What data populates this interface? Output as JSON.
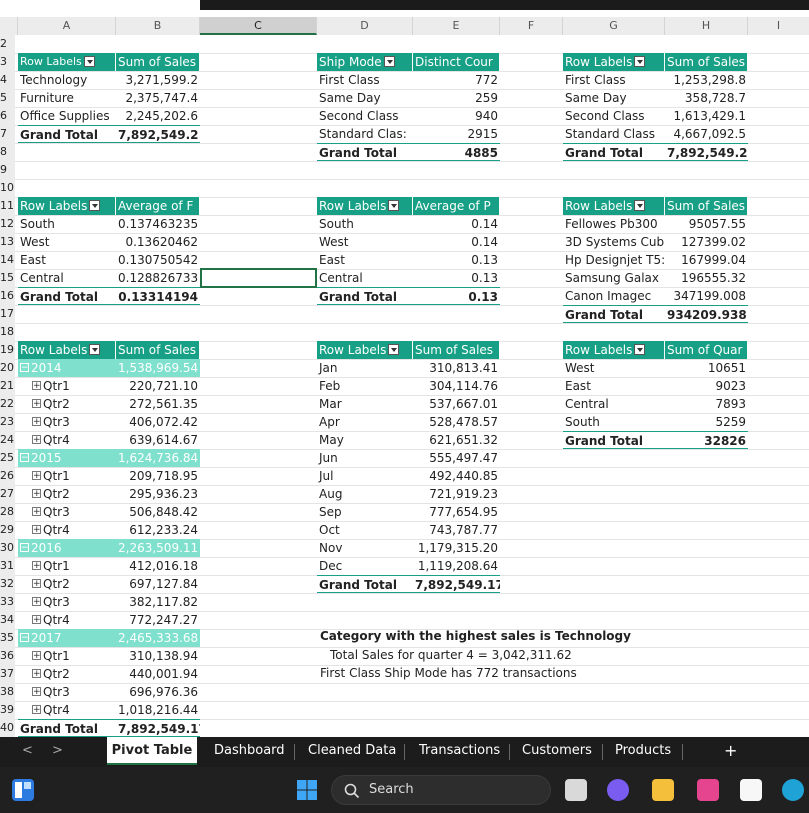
{
  "columns": [
    "A",
    "B",
    "C",
    "D",
    "E",
    "F",
    "G",
    "H",
    "I"
  ],
  "rows": [
    "2",
    "3",
    "4",
    "5",
    "6",
    "7",
    "8",
    "9",
    "10",
    "11",
    "12",
    "13",
    "14",
    "15",
    "16",
    "17",
    "18",
    "19",
    "20",
    "21",
    "22",
    "23",
    "24",
    "25",
    "26",
    "27",
    "28",
    "29",
    "30",
    "31",
    "32",
    "33",
    "34",
    "35",
    "36",
    "37",
    "38",
    "39",
    "40"
  ],
  "pivot1": {
    "headers": [
      "Row Labels",
      "Sum of Sales"
    ],
    "rows": [
      [
        "Technology",
        "3,271,599.2"
      ],
      [
        "Furniture",
        "2,375,747.4"
      ],
      [
        "Office Supplies",
        "2,245,202.6"
      ]
    ],
    "total": [
      "Grand Total",
      "7,892,549.2"
    ]
  },
  "pivot2": {
    "headers": [
      "Ship Mode",
      "Distinct Cour"
    ],
    "rows": [
      [
        "First Class",
        "772"
      ],
      [
        "Same Day",
        "259"
      ],
      [
        "Second Class",
        "940"
      ],
      [
        "Standard Clas:",
        "2915"
      ]
    ],
    "total": [
      "Grand Total",
      "4885"
    ]
  },
  "pivot3": {
    "headers": [
      "Row Labels",
      "Sum of Sales"
    ],
    "rows": [
      [
        "First Class",
        "1,253,298.8"
      ],
      [
        "Same Day",
        "358,728.7"
      ],
      [
        "Second Class",
        "1,613,429.1"
      ],
      [
        "Standard Class",
        "4,667,092.5"
      ]
    ],
    "total": [
      "Grand Total",
      "7,892,549.2"
    ]
  },
  "pivot4": {
    "headers": [
      "Row Labels",
      "Average of F"
    ],
    "rows": [
      [
        "South",
        "0.137463235"
      ],
      [
        "West",
        "0.13620462"
      ],
      [
        "East",
        "0.130750542"
      ],
      [
        "Central",
        "0.128826733"
      ]
    ],
    "total": [
      "Grand Total",
      "0.13314194"
    ]
  },
  "pivot5": {
    "headers": [
      "Row Labels",
      "Average of P"
    ],
    "rows": [
      [
        "South",
        "0.14"
      ],
      [
        "West",
        "0.14"
      ],
      [
        "East",
        "0.13"
      ],
      [
        "Central",
        "0.13"
      ]
    ],
    "total": [
      "Grand Total",
      "0.13"
    ]
  },
  "pivot6": {
    "headers": [
      "Row Labels",
      "Sum of Sales"
    ],
    "rows": [
      [
        "Fellowes Pb300",
        "95057.55"
      ],
      [
        "3D Systems Cub",
        "127399.02"
      ],
      [
        "Hp Designjet T5:",
        "167999.04"
      ],
      [
        "Samsung Galax",
        "196555.32"
      ],
      [
        "Canon Imagec",
        "347199.008"
      ]
    ],
    "total": [
      "Grand Total",
      "934209.938"
    ]
  },
  "pivot7": {
    "headers": [
      "Row Labels",
      "Sum of Sales"
    ],
    "years": [
      {
        "year": "2014",
        "total": "1,538,969.54",
        "q": [
          [
            "Qtr1",
            "220,721.10"
          ],
          [
            "Qtr2",
            "272,561.35"
          ],
          [
            "Qtr3",
            "406,072.42"
          ],
          [
            "Qtr4",
            "639,614.67"
          ]
        ]
      },
      {
        "year": "2015",
        "total": "1,624,736.84",
        "q": [
          [
            "Qtr1",
            "209,718.95"
          ],
          [
            "Qtr2",
            "295,936.23"
          ],
          [
            "Qtr3",
            "506,848.42"
          ],
          [
            "Qtr4",
            "612,233.24"
          ]
        ]
      },
      {
        "year": "2016",
        "total": "2,263,509.11",
        "q": [
          [
            "Qtr1",
            "412,016.18"
          ],
          [
            "Qtr2",
            "697,127.84"
          ],
          [
            "Qtr3",
            "382,117.82"
          ],
          [
            "Qtr4",
            "772,247.27"
          ]
        ]
      },
      {
        "year": "2017",
        "total": "2,465,333.68",
        "q": [
          [
            "Qtr1",
            "310,138.94"
          ],
          [
            "Qtr2",
            "440,001.94"
          ],
          [
            "Qtr3",
            "696,976.36"
          ],
          [
            "Qtr4",
            "1,018,216.44"
          ]
        ]
      }
    ],
    "total": [
      "Grand Total",
      "7,892,549.17"
    ]
  },
  "pivot8": {
    "headers": [
      "Row Labels",
      "Sum of Sales"
    ],
    "rows": [
      [
        "Jan",
        "310,813.41"
      ],
      [
        "Feb",
        "304,114.76"
      ],
      [
        "Mar",
        "537,667.01"
      ],
      [
        "Apr",
        "528,478.57"
      ],
      [
        "May",
        "621,651.32"
      ],
      [
        "Jun",
        "555,497.47"
      ],
      [
        "Jul",
        "492,440.85"
      ],
      [
        "Aug",
        "721,919.23"
      ],
      [
        "Sep",
        "777,654.95"
      ],
      [
        "Oct",
        "743,787.77"
      ],
      [
        "Nov",
        "1,179,315.20"
      ],
      [
        "Dec",
        "1,119,208.64"
      ]
    ],
    "total": [
      "Grand Total",
      "7,892,549.17"
    ]
  },
  "pivot9": {
    "headers": [
      "Row Labels",
      "Sum of Quar"
    ],
    "rows": [
      [
        "West",
        "10651"
      ],
      [
        "East",
        "9023"
      ],
      [
        "Central",
        "7893"
      ],
      [
        "South",
        "5259"
      ]
    ],
    "total": [
      "Grand Total",
      "32826"
    ]
  },
  "notes": {
    "line1": "Category with the highest sales is Technology",
    "line2": "Total Sales for quarter 4 = 3,042,311.62",
    "line3": "First Class Ship Mode has 772 transactions"
  },
  "sheet_tabs": {
    "prev": "<",
    "next": ">",
    "active": "Pivot Table",
    "others": [
      "Dashboard",
      "Cleaned Data",
      "Transactions",
      "Customers",
      "Products"
    ],
    "add": "+"
  },
  "taskbar": {
    "search": "Search"
  },
  "colors": {
    "pivot_header": "#17a085",
    "year_row": "#7ee0cd",
    "selection": "#217346"
  }
}
